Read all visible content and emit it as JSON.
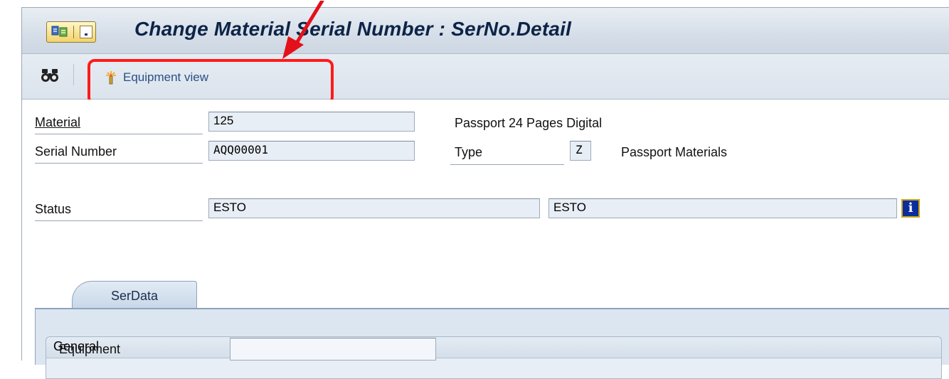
{
  "window": {
    "title": "Change Material Serial Number : SerNo.Detail"
  },
  "toolbar": {
    "find_icon": "binoculars-icon",
    "equipment_view_label": "Equipment view",
    "equipment_view_icon": "wand-icon"
  },
  "annotation": {
    "highlight_color": "#ff1a1a"
  },
  "form": {
    "material_label": "Material",
    "material_value": "125",
    "material_description": "Passport 24 Pages Digital",
    "serial_label": "Serial Number",
    "serial_value": "AQQ00001",
    "type_label": "Type",
    "type_value": "Z",
    "type_description": "Passport Materials",
    "status_label": "Status",
    "status_value_1": "ESTO",
    "status_value_2": "ESTO",
    "status_info_icon": "info-icon"
  },
  "tabs": [
    {
      "label": "SerData",
      "active": true
    }
  ],
  "general_group": {
    "title": "General",
    "equipment_label": "Equipment",
    "equipment_value": ""
  }
}
